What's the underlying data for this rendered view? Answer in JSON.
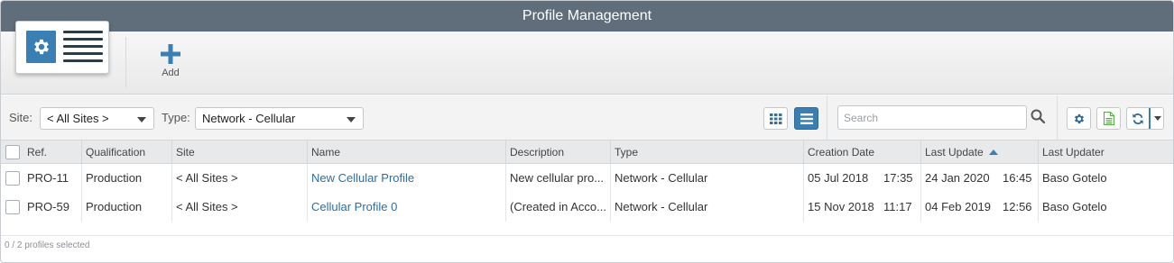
{
  "window": {
    "title": "Profile Management"
  },
  "ribbon": {
    "add_label": "Add"
  },
  "filters": {
    "site_label": "Site:",
    "site_value": "< All Sites >",
    "type_label": "Type:",
    "type_value": "Network - Cellular"
  },
  "search": {
    "placeholder": "Search",
    "value": ""
  },
  "columns": [
    "Ref.",
    "Qualification",
    "Site",
    "Name",
    "Description",
    "Type",
    "Creation Date",
    "Last Update",
    "Last Updater"
  ],
  "sort": {
    "column": "Last Update",
    "direction": "ascending"
  },
  "rows": [
    {
      "ref": "PRO-11",
      "qualification": "Production",
      "site": "< All Sites >",
      "name": "New Cellular Profile",
      "description": "New cellular pro...",
      "type": "Network - Cellular",
      "created_date": "05 Jul 2018",
      "created_time": "17:35",
      "updated_date": "24 Jan 2020",
      "updated_time": "16:45",
      "updater": "Baso Gotelo"
    },
    {
      "ref": "PRO-59",
      "qualification": "Production",
      "site": "< All Sites >",
      "name": "Cellular Profile 0",
      "description": "(Created in Acco...",
      "type": "Network - Cellular",
      "created_date": "15 Nov 2018",
      "created_time": "11:17",
      "updated_date": "04 Feb 2019",
      "updated_time": "12:56",
      "updater": "Baso Gotelo"
    }
  ],
  "footer": {
    "selection_status": "0 / 2 profiles selected"
  },
  "icons": {
    "app": "profile-settings-icon",
    "add": "plus-icon",
    "grid_view": "grid-view-icon",
    "list_view": "list-view-icon",
    "search": "search-icon",
    "settings": "gear-icon",
    "export": "excel-export-icon",
    "refresh": "refresh-icon"
  },
  "colors": {
    "titlebar": "#5f6e7a",
    "accent": "#3a7fb3",
    "link": "#2c6ea3",
    "export_green": "#5aa74a"
  }
}
